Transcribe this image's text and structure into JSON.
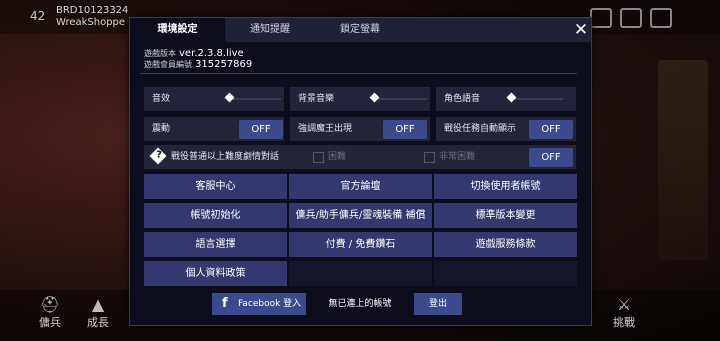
{
  "background": {
    "level": "42",
    "player": "BRD10123324",
    "shop": "WreakShoppe",
    "left_button": "傭兵",
    "mid_button": "成長",
    "right_button": "挑戰"
  },
  "tabs": [
    {
      "label": "環境設定",
      "active": true
    },
    {
      "label": "通知提醒",
      "active": false
    },
    {
      "label": "鎖定螢幕",
      "active": false
    }
  ],
  "close_icon": "close-icon",
  "info": {
    "version_label": "遊戲版本",
    "version_value": "ver.2.3.8.live",
    "member_label": "遊戲會員編號",
    "member_value": "315257869"
  },
  "sound": {
    "sfx_label": "音效",
    "bgm_label": "背景音樂",
    "voice_label": "角色語音"
  },
  "toggles": {
    "vibration_label": "震動",
    "vibration_value": "OFF",
    "boss_label": "強調魔王出現",
    "boss_value": "OFF",
    "autoshow_label": "戰役任務自動顯示",
    "autoshow_value": "OFF"
  },
  "story": {
    "label": "戰役普通以上難度劇情對話",
    "hard_label": "困難",
    "veryhard_label": "非常困難",
    "value": "OFF"
  },
  "buttons": [
    "客服中心",
    "官方論壇",
    "切換使用者帳號",
    "帳號初始化",
    "傭兵/助手傭兵/靈魂裝備 補償",
    "標準版本變更",
    "語言選擇",
    "付費 / 免費鑽石",
    "遊戲服務條款",
    "個人資料政策"
  ],
  "account": {
    "facebook_label": "Facebook 登入",
    "status": "無已連上的帳號",
    "logout": "登出"
  }
}
